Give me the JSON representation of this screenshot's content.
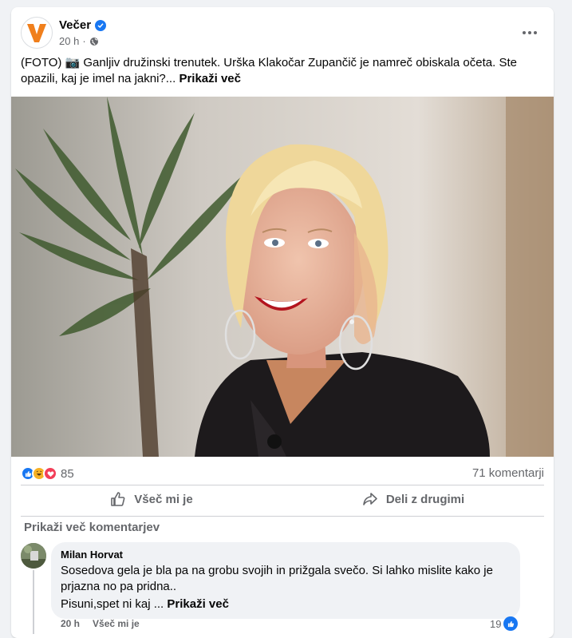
{
  "post": {
    "page_name": "Večer",
    "avatar_letter": "V",
    "time": "20 h",
    "audience_icon": "globe-icon",
    "text": "(FOTO) 📷 Ganljiv družinski trenutek. Urška Klakočar Zupančič je namreč obiskala očeta. Ste opazili, kaj je imel na jakni?...",
    "see_more": "Prikaži več"
  },
  "reactions": {
    "icons": [
      "like-icon",
      "haha-icon",
      "love-icon"
    ],
    "count": "85",
    "comments": "71 komentarji"
  },
  "actions": {
    "like": "Všeč mi je",
    "share": "Deli z drugimi"
  },
  "comments": {
    "show_more": "Prikaži več komentarjev",
    "items": [
      {
        "author": "Milan Horvat",
        "text": "Sosedova gela je bla pa na grobu svojih in prižgala svečo. Si lahko mislite kako je prjazna no pa pridna..",
        "text2": "Pisuni,spet ni kaj ...",
        "see_more": "Prikaži več",
        "time": "20 h",
        "like": "Všeč mi je",
        "likes": "19"
      }
    ]
  },
  "colors": {
    "brand": "#1877f2",
    "vecer_orange": "#f07f1c",
    "secondary_text": "#65676b"
  }
}
